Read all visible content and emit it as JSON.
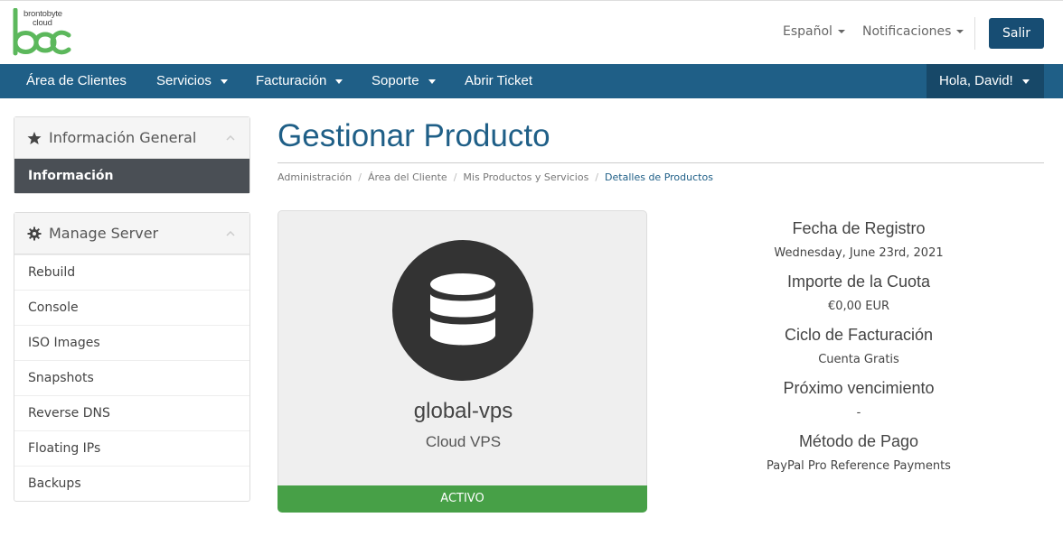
{
  "logo": {
    "line1": "brontobyte",
    "line2": "cloud"
  },
  "header": {
    "language_label": "Español",
    "notifications_label": "Notificaciones",
    "logout_label": "Salir"
  },
  "nav": {
    "items": [
      {
        "label": "Área de Clientes"
      },
      {
        "label": "Servicios"
      },
      {
        "label": "Facturación"
      },
      {
        "label": "Soporte"
      },
      {
        "label": "Abrir Ticket"
      }
    ],
    "user_label": "Hola, David!"
  },
  "sidebar": {
    "general": {
      "title": "Información General",
      "active_item": "Información"
    },
    "manage": {
      "title": "Manage Server",
      "items": [
        "Rebuild",
        "Console",
        "ISO Images",
        "Snapshots",
        "Reverse DNS",
        "Floating IPs",
        "Backups"
      ]
    }
  },
  "main": {
    "title": "Gestionar Producto",
    "breadcrumb": [
      "Administración",
      "Área del Cliente",
      "Mis Productos y Servicios",
      "Detalles de Productos"
    ],
    "product": {
      "name": "global-vps",
      "group": "Cloud VPS",
      "status": "ACTIVO"
    },
    "details": {
      "reg_date_label": "Fecha de Registro",
      "reg_date_value": "Wednesday, June 23rd, 2021",
      "amount_label": "Importe de la Cuota",
      "amount_value": "€0,00 EUR",
      "cycle_label": "Ciclo de Facturación",
      "cycle_value": "Cuenta Gratis",
      "due_label": "Próximo vencimiento",
      "due_value": "-",
      "payment_label": "Método de Pago",
      "payment_value": "PayPal Pro Reference Payments"
    }
  },
  "colors": {
    "brand": "#1f5f87",
    "logo_green": "#5cb85c",
    "status_active": "#47a047"
  }
}
